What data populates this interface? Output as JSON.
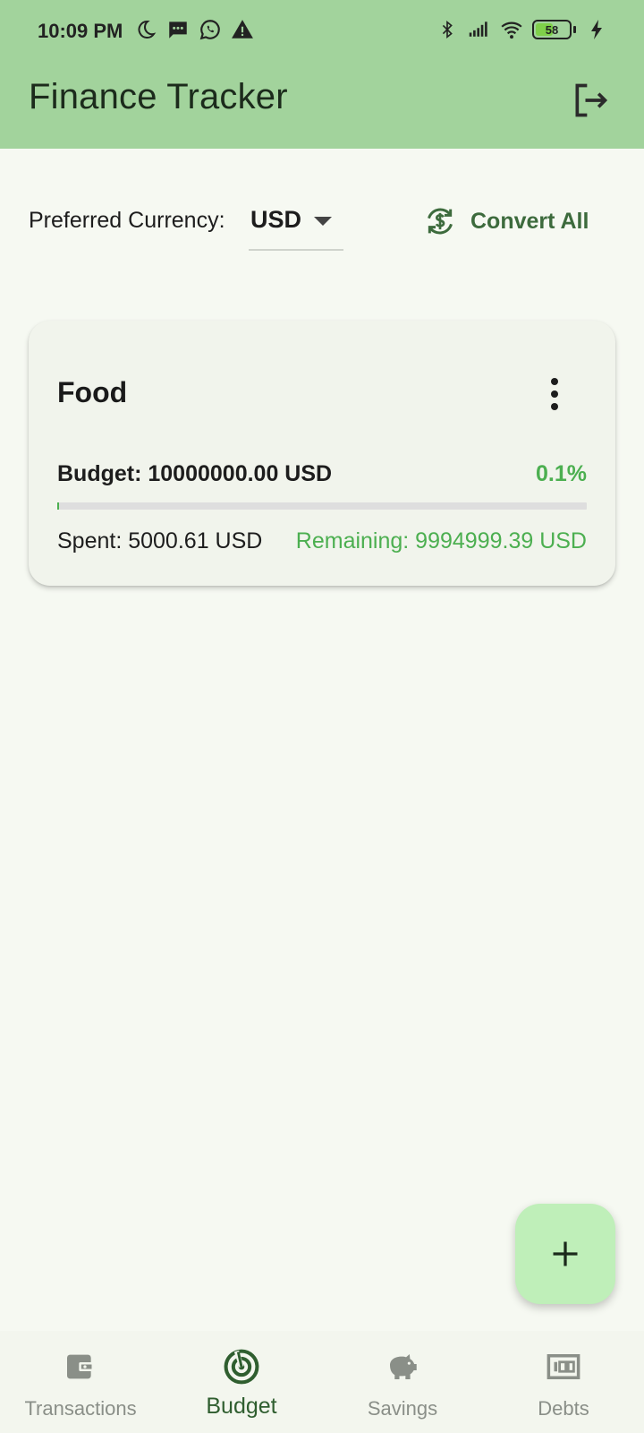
{
  "status_bar": {
    "time": "10:09 PM",
    "battery_level": "58",
    "battery_fraction": 0.58
  },
  "app_bar": {
    "title": "Finance Tracker",
    "logout_icon": "logout-icon"
  },
  "currency": {
    "label": "Preferred Currency:",
    "selected": "USD",
    "convert_label": "Convert All"
  },
  "budgets": [
    {
      "category": "Food",
      "budget_text": "Budget: 10000000.00 USD",
      "percent_text": "0.1%",
      "progress_fraction": 0.001,
      "spent_text": "Spent: 5000.61 USD",
      "remaining_text": "Remaining: 9994999.39 USD"
    }
  ],
  "bottom_nav": {
    "items": [
      {
        "label": "Transactions",
        "icon": "wallet-icon",
        "active": false
      },
      {
        "label": "Budget",
        "icon": "budget-target-icon",
        "active": true
      },
      {
        "label": "Savings",
        "icon": "piggy-bank-icon",
        "active": false
      },
      {
        "label": "Debts",
        "icon": "money-icon",
        "active": false
      }
    ]
  },
  "colors": {
    "app_bar": "#a2d39c",
    "accent_green": "#4caf50",
    "fab": "#bfefb9",
    "active_nav": "#2f5e2f",
    "inactive_nav": "#8a8f88"
  }
}
